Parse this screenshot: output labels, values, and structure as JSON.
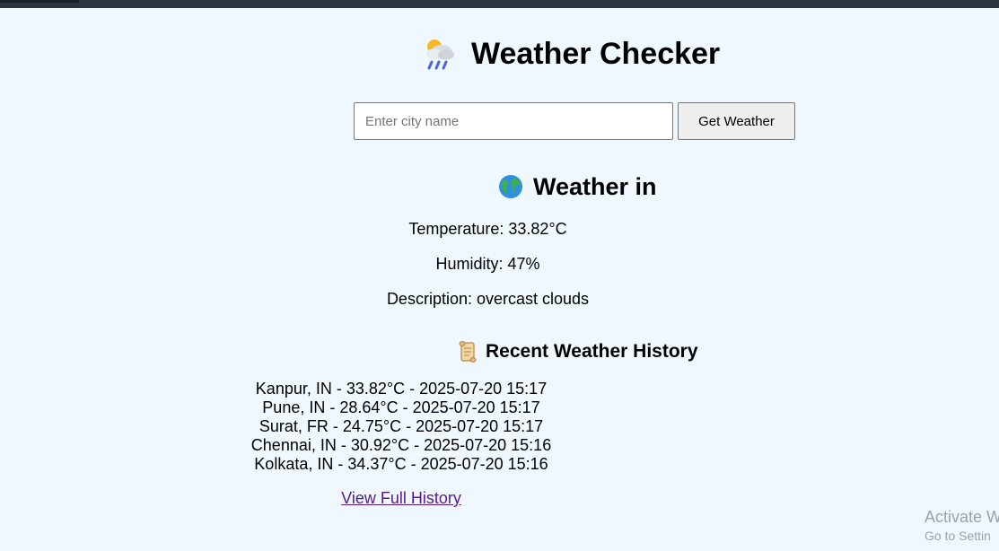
{
  "header": {
    "title": "Weather Checker",
    "title_icon": "cloud-rain-sun-icon"
  },
  "search": {
    "placeholder": "Enter city name",
    "value": "",
    "button_label": "Get Weather"
  },
  "current": {
    "heading": "Weather in",
    "heading_icon": "globe-icon",
    "temperature_line": "Temperature: 33.82°C",
    "humidity_line": "Humidity: 47%",
    "description_line": "Description: overcast clouds"
  },
  "history": {
    "heading": "Recent Weather History",
    "heading_icon": "scroll-icon",
    "items": [
      "Kanpur, IN - 33.82°C - 2025-07-20 15:17",
      "Pune, IN - 28.64°C - 2025-07-20 15:17",
      "Surat, FR - 24.75°C - 2025-07-20 15:17",
      "Chennai, IN - 30.92°C - 2025-07-20 15:16",
      "Kolkata, IN - 34.37°C - 2025-07-20 15:16"
    ],
    "link_label": "View Full History"
  },
  "watermark": {
    "line1": "Activate W",
    "line2": "Go to Settin"
  },
  "colors": {
    "background": "#eff8ff",
    "link": "#551a8b"
  }
}
